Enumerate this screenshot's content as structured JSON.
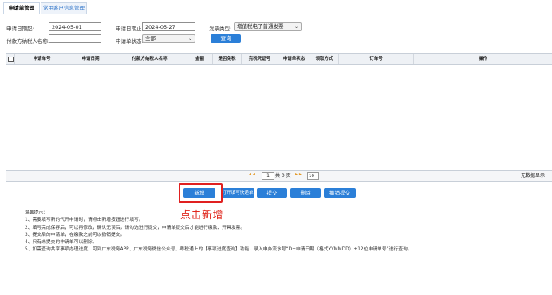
{
  "tabs": [
    {
      "label": "申请单管理",
      "active": true
    },
    {
      "label": "常用客户信息管理",
      "active": false
    }
  ],
  "filters": {
    "start_date_label": "申请日期起:",
    "start_date_value": "2024-05-01",
    "end_date_label": "申请日期止:",
    "end_date_value": "2024-05-27",
    "invoice_type_label": "发票类型:",
    "invoice_type_value": "增值税电子普通发票",
    "payer_label": "付款方纳税人名称:",
    "payer_value": "",
    "status_label": "申请单状态:",
    "status_value": "全部",
    "query_button": "查询"
  },
  "grid": {
    "columns": [
      "申请单号",
      "申请日期",
      "付款方纳税人名称",
      "金额",
      "是否免税",
      "完税凭证号",
      "申请单状态",
      "领取方式",
      "订单号",
      "操作"
    ],
    "rows": []
  },
  "pager": {
    "prev_arrows": "◂ ◂",
    "page_value": "1",
    "total_text": "共 0 页",
    "next_arrows": "▸ ▸",
    "page_size": "10",
    "no_data_text": "无数据显示"
  },
  "actions": [
    {
      "label": "新增"
    },
    {
      "label": "打开填写快递单"
    },
    {
      "label": "提交"
    },
    {
      "label": "删除"
    },
    {
      "label": "撤销提交"
    }
  ],
  "annotation": {
    "text": "点击新增",
    "color": "#e0281e"
  },
  "tips": {
    "title": "温馨提示:",
    "lines": [
      "1、需要填写新的代开申请时，请点击新增按钮进行填写。",
      "2、填写完成保存后，可以再修改，确认无误后，请勾选进行提交，申请单提交后才能进行缴款、开具发票。",
      "3、提交后的申请单，在缴款之前可以撤销提交。",
      "4、只有未提交的申请单可以删除。",
      "5、如需查询共享事项办理进度，可到广东税务APP、广东税务微信公众号、粤税通上的【事项进度查询】功能，录入申办流水号“D+申请日期（格式YYMMDD）+12位申请单号”进行查询。"
    ]
  },
  "colors": {
    "primary_button": "#2b7fd8",
    "tab_link": "#2f74c9",
    "highlight": "#e02020"
  }
}
